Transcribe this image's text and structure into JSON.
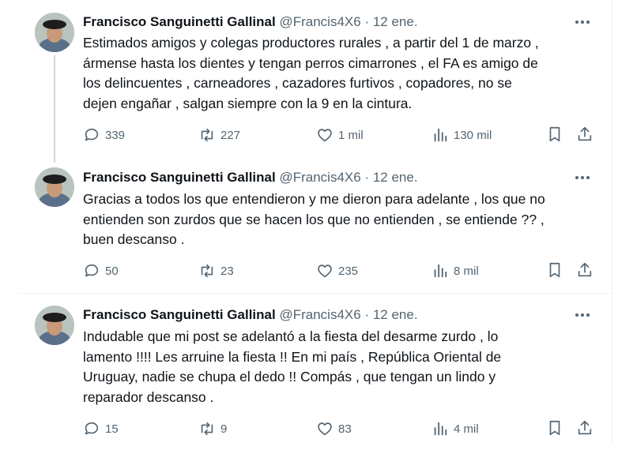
{
  "tweets": [
    {
      "name": "Francisco Sanguinetti Gallinal",
      "handle": "@Francis4X6",
      "date": "· 12 ene.",
      "text": "Estimados amigos y colegas productores rurales , a partir del 1 de marzo ,\nármense hasta los dientes y tengan perros cimarrones , el FA es amigo de\nlos delincuentes , carneadores , cazadores furtivos , copadores, no se\ndejen engañar , salgan siempre con la 9 en la cintura.",
      "replies": "339",
      "retweets": "227",
      "likes": "1 mil",
      "views": "130 mil"
    },
    {
      "name": "Francisco Sanguinetti Gallinal",
      "handle": "@Francis4X6",
      "date": "· 12 ene.",
      "text": "Gracias a todos los que entendieron y me dieron para adelante , los que no\nentienden son zurdos que se hacen los que no entienden , se entiende ?? ,\nbuen descanso .",
      "replies": "50",
      "retweets": "23",
      "likes": "235",
      "views": "8 mil"
    },
    {
      "name": "Francisco Sanguinetti Gallinal",
      "handle": "@Francis4X6",
      "date": "· 12 ene.",
      "text": "Indudable que mi post se adelantó a la fiesta del desarme zurdo , lo\nlamento !!!! Les arruine la fiesta !! En mi país , República Oriental de\nUruguay, nadie se chupa el dedo  !! Compás , que tengan un lindo y\nreparador descanso .",
      "replies": "15",
      "retweets": "9",
      "likes": "83",
      "views": "4 mil"
    }
  ],
  "colors": {
    "text": "#0f1419",
    "secondary": "#536471",
    "border": "#eff3f4",
    "thread_line": "#cfd9de"
  },
  "icons": [
    "reply-icon",
    "retweet-icon",
    "like-icon",
    "views-icon",
    "bookmark-icon",
    "share-icon",
    "more-icon"
  ]
}
